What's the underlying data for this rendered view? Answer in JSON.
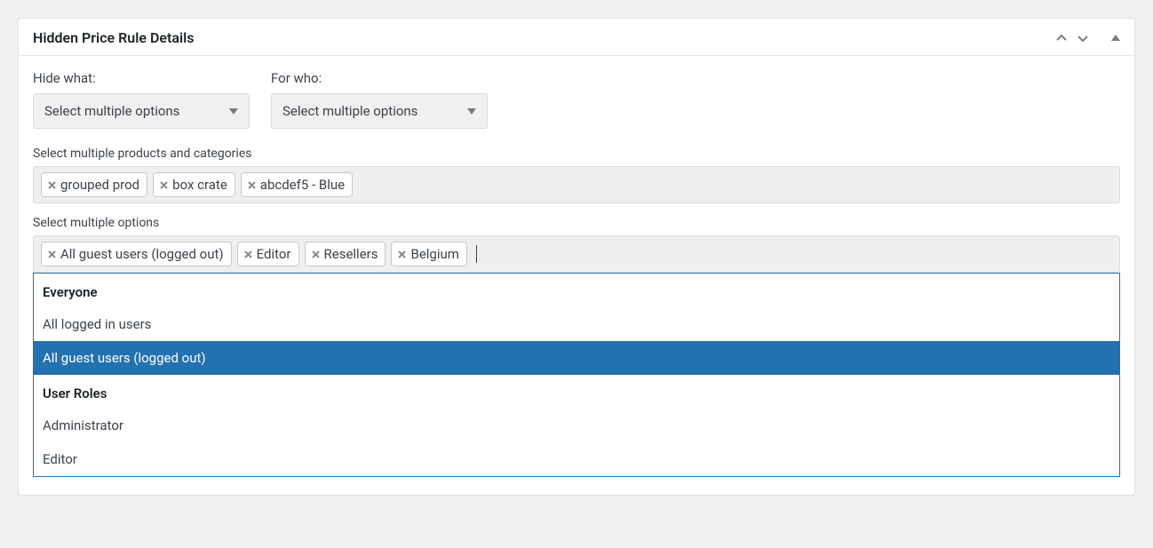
{
  "panel": {
    "title": "Hidden Price Rule Details"
  },
  "fields": {
    "hide_what": {
      "label": "Hide what:",
      "placeholder": "Select multiple options"
    },
    "for_who": {
      "label": "For who:",
      "placeholder": "Select multiple options"
    }
  },
  "products": {
    "label": "Select multiple products and categories",
    "tags": [
      "grouped prod",
      "box crate",
      "abcdef5 - Blue"
    ]
  },
  "options": {
    "label": "Select multiple options",
    "tags": [
      "All guest users (logged out)",
      "Editor",
      "Resellers",
      "Belgium"
    ]
  },
  "dropdown": {
    "groups": [
      {
        "label": "Everyone",
        "options": [
          {
            "label": "All logged in users",
            "selected": false
          },
          {
            "label": "All guest users (logged out)",
            "selected": true
          }
        ]
      },
      {
        "label": "User Roles",
        "options": [
          {
            "label": "Administrator",
            "selected": false
          },
          {
            "label": "Editor",
            "selected": false
          }
        ]
      }
    ]
  }
}
